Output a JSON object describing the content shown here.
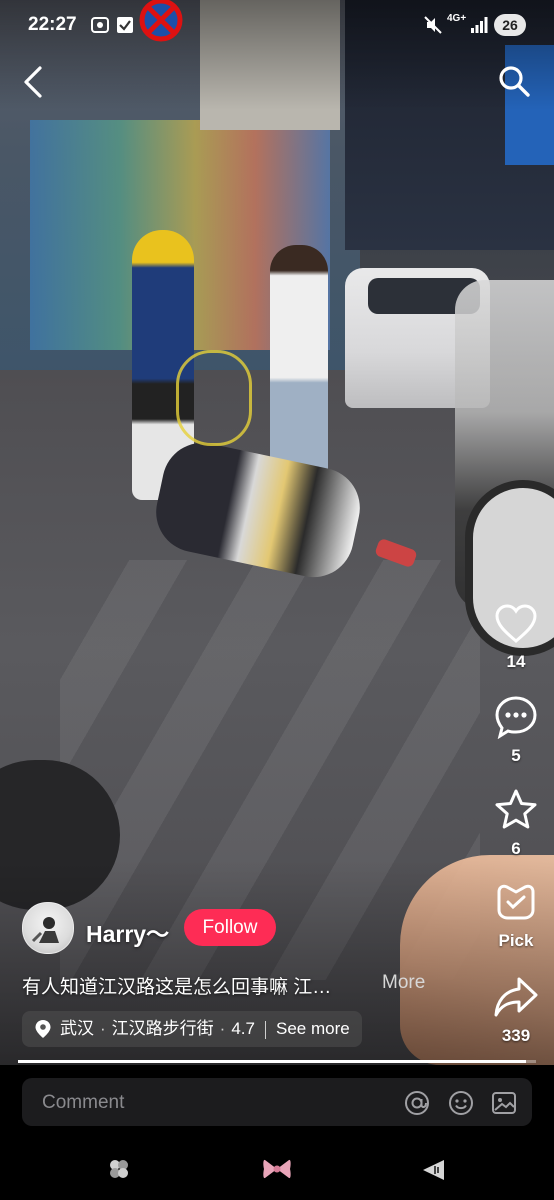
{
  "status_bar": {
    "time": "22:27",
    "battery": "26",
    "network": "4G+"
  },
  "icons": {
    "back": "arrow-left-icon",
    "search": "search-icon",
    "like": "heart-icon",
    "comment": "comment-bubble-icon",
    "favorite": "star-icon",
    "pick": "pick-icon",
    "share": "share-arrow-icon",
    "location": "location-pin-icon",
    "mention": "at-sign-icon",
    "emoji": "emoji-icon",
    "image": "image-icon"
  },
  "actions": {
    "likes": "14",
    "comments": "5",
    "favorites": "6",
    "pick_label": "Pick",
    "shares": "339"
  },
  "post": {
    "author": "Harry～",
    "follow_label": "Follow",
    "caption": "有人知道江汉路这是怎么回事嘛 江…",
    "more_label": "More",
    "location": {
      "city": "武汉",
      "place": "江汉路步行街",
      "rating": "4.7",
      "see_more": "See more"
    },
    "progress": 0.98
  },
  "comment_bar": {
    "placeholder": "Comment"
  },
  "colors": {
    "follow": "#fe2c55",
    "background": "#000000"
  }
}
